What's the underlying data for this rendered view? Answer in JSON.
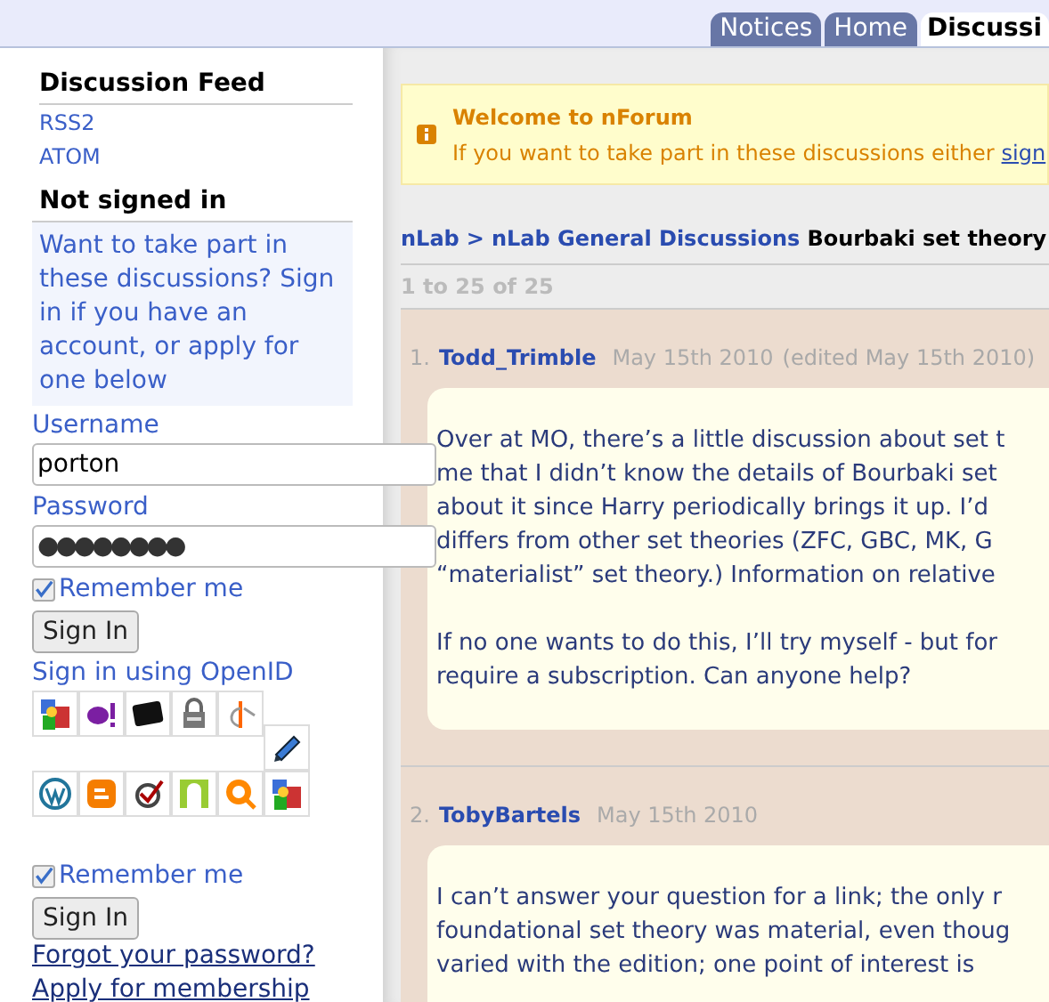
{
  "tabs": [
    {
      "label": "Notices",
      "selected": false
    },
    {
      "label": "Home",
      "selected": false
    },
    {
      "label": "Discussi",
      "selected": true
    }
  ],
  "sidebar": {
    "feed_title": "Discussion Feed",
    "feed_links": [
      "RSS2",
      "ATOM"
    ],
    "signin_title": "Not signed in",
    "signin_note": "Want to take part in these discussions? Sign in if you have an account, or apply for one below",
    "username_label": "Username",
    "username_value": "porton",
    "password_label": "Password",
    "password_value": "●●●●●●●●",
    "remember": {
      "label": "Remember me",
      "checked": true
    },
    "sign_in_button": "Sign In",
    "openid_title": "Sign in using OpenID",
    "openid_remember": {
      "label": "Remember me",
      "checked": true
    },
    "openid_button": "Sign In",
    "links": [
      "Forgot your password?",
      "Apply for membership"
    ]
  },
  "notice": {
    "title": "Welcome to nForum",
    "text": "If you want to take part in these discussions either",
    "link": "sign"
  },
  "breadcrumb": {
    "links": [
      "nLab",
      ">",
      "nLab General Discussions"
    ],
    "title": "Bourbaki set theory"
  },
  "pager": "1 to 25 of 25",
  "posts": [
    {
      "number": "1.",
      "author": "Todd_Trimble",
      "date": "May 15th 2010",
      "edited": "(edited May 15th 2010)",
      "paragraphs": [
        [
          "Over at MO, there’s a little discussion about set t",
          "me that I didn’t know the details of Bourbaki set",
          "about it since Harry periodically brings it up. I’d",
          "differs from other set theories (ZFC, GBC, MK, G",
          "“materialist” set theory.) Information on relative"
        ],
        [
          "If no one wants to do this, I’ll try myself - but for",
          "require a subscription. Can anyone help?"
        ]
      ]
    },
    {
      "number": "2.",
      "author": "TobyBartels",
      "date": "May 15th 2010",
      "paragraphs": [
        [
          "I can’t answer your question for a link; the only r",
          "foundational set theory was material, even thoug",
          "varied with the edition; one point of interest is"
        ]
      ]
    }
  ]
}
